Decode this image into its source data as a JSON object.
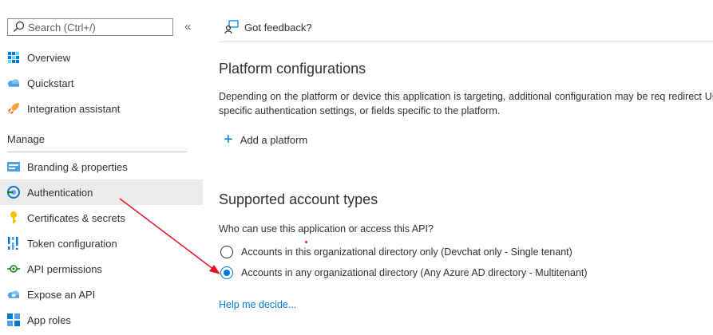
{
  "sidebar": {
    "search_placeholder": "Search (Ctrl+/)",
    "collapse_glyph": "«",
    "items_top": [
      {
        "label": "Overview",
        "icon": "overview-grid-icon"
      },
      {
        "label": "Quickstart",
        "icon": "cloud-icon"
      },
      {
        "label": "Integration assistant",
        "icon": "rocket-icon"
      }
    ],
    "section_label": "Manage",
    "items_manage": [
      {
        "label": "Branding & properties",
        "icon": "branding-icon"
      },
      {
        "label": "Authentication",
        "icon": "authentication-icon",
        "active": true
      },
      {
        "label": "Certificates & secrets",
        "icon": "key-icon"
      },
      {
        "label": "Token configuration",
        "icon": "token-bars-icon"
      },
      {
        "label": "API permissions",
        "icon": "api-permissions-icon"
      },
      {
        "label": "Expose an API",
        "icon": "cloud-api-icon"
      },
      {
        "label": "App roles",
        "icon": "app-roles-icon"
      }
    ]
  },
  "toolbar": {
    "feedback_label": "Got feedback?"
  },
  "main": {
    "platform_title": "Platform configurations",
    "platform_description": "Depending on the platform or device this application is targeting, additional configuration may be req redirect URIs, specific authentication settings, or fields specific to the platform.",
    "add_platform_label": "Add a platform",
    "account_title": "Supported account types",
    "account_question": "Who can use this application or access this API?",
    "account_options": [
      {
        "label": "Accounts in this organizational directory only (Devchat only - Single tenant)",
        "selected": false
      },
      {
        "label": "Accounts in any organizational directory (Any Azure AD directory - Multitenant)",
        "selected": true
      }
    ],
    "help_link": "Help me decide..."
  },
  "colors": {
    "accent": "#0078d4",
    "annotation": "#e81123",
    "active_bg": "#edebe9"
  }
}
